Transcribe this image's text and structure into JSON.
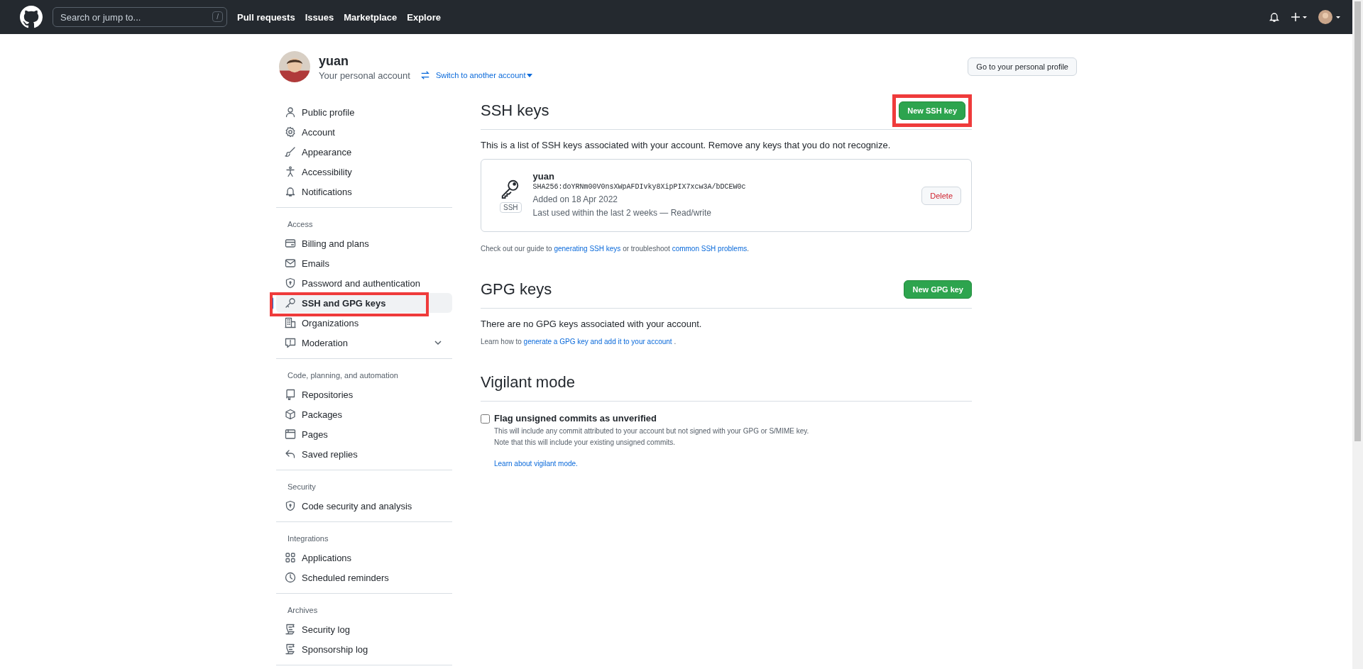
{
  "topbar": {
    "search": {
      "placeholder": "Search or jump to...",
      "shortcut": "/"
    },
    "nav": [
      "Pull requests",
      "Issues",
      "Marketplace",
      "Explore"
    ]
  },
  "account": {
    "name": "yuan",
    "subtitle": "Your personal account",
    "switch_link": "Switch to another account",
    "profile_button": "Go to your personal profile"
  },
  "sidebar": {
    "sections": [
      {
        "items": [
          {
            "label": "Public profile",
            "selected": false
          },
          {
            "label": "Account",
            "selected": false
          },
          {
            "label": "Appearance",
            "selected": false
          },
          {
            "label": "Accessibility",
            "selected": false
          },
          {
            "label": "Notifications",
            "selected": false
          }
        ]
      },
      {
        "heading": "Access",
        "items": [
          {
            "label": "Billing and plans",
            "selected": false
          },
          {
            "label": "Emails",
            "selected": false
          },
          {
            "label": "Password and authentication",
            "selected": false
          },
          {
            "label": "SSH and GPG keys",
            "selected": true,
            "highlighted": true
          },
          {
            "label": "Organizations",
            "selected": false
          },
          {
            "label": "Moderation",
            "selected": false,
            "expandable": true
          }
        ]
      },
      {
        "heading": "Code, planning, and automation",
        "items": [
          {
            "label": "Repositories",
            "selected": false
          },
          {
            "label": "Packages",
            "selected": false
          },
          {
            "label": "Pages",
            "selected": false
          },
          {
            "label": "Saved replies",
            "selected": false
          }
        ]
      },
      {
        "heading": "Security",
        "items": [
          {
            "label": "Code security and analysis",
            "selected": false
          }
        ]
      },
      {
        "heading": "Integrations",
        "items": [
          {
            "label": "Applications",
            "selected": false
          },
          {
            "label": "Scheduled reminders",
            "selected": false
          }
        ]
      },
      {
        "heading": "Archives",
        "items": [
          {
            "label": "Security log",
            "selected": false
          },
          {
            "label": "Sponsorship log",
            "selected": false
          }
        ]
      }
    ]
  },
  "ssh": {
    "title": "SSH keys",
    "button": "New SSH key",
    "button_highlighted": true,
    "intro": "This is a list of SSH keys associated with your account. Remove any keys that you do not recognize.",
    "keys": [
      {
        "name": "yuan",
        "fingerprint": "SHA256:doYRNm00V0nsXWpAFDIvky8XipPIX7xcw3A/bDCEW0c",
        "badge": "SSH",
        "added": "Added on 18 Apr 2022",
        "last_used": "Last used within the last 2 weeks — Read/write",
        "delete": "Delete"
      }
    ],
    "footer": [
      "Check out our guide to ",
      {
        "link": "generating SSH keys"
      },
      " or troubleshoot ",
      {
        "link": "common SSH problems"
      },
      "."
    ]
  },
  "gpg": {
    "title": "GPG keys",
    "button": "New GPG key",
    "empty": "There are no GPG keys associated with your account.",
    "footer": [
      "Learn how to ",
      {
        "link": "generate a GPG key and add it to your account"
      },
      " ."
    ]
  },
  "vigilant": {
    "title": "Vigilant mode",
    "checkbox": {
      "label": "Flag unsigned commits as unverified",
      "checked": false
    },
    "notes": [
      "This will include any commit attributed to your account but not signed with your GPG or S/MIME key.",
      "Note that this will include your existing unsigned commits."
    ],
    "link": "Learn about vigilant mode."
  }
}
